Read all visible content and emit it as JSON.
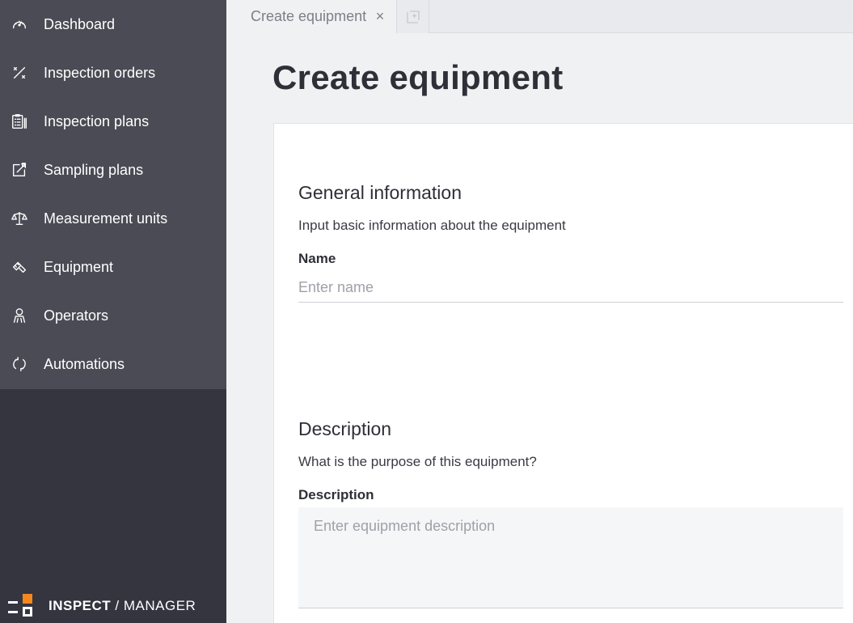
{
  "sidebar": {
    "items": [
      {
        "label": "Dashboard",
        "icon": "gauge-icon"
      },
      {
        "label": "Inspection orders",
        "icon": "percent-icon"
      },
      {
        "label": "Inspection plans",
        "icon": "clipboard-list-icon"
      },
      {
        "label": "Sampling plans",
        "icon": "chart-export-icon"
      },
      {
        "label": "Measurement units",
        "icon": "scale-icon"
      },
      {
        "label": "Equipment",
        "icon": "tools-icon"
      },
      {
        "label": "Operators",
        "icon": "person-icon"
      },
      {
        "label": "Automations",
        "icon": "refresh-icon"
      }
    ],
    "brand": {
      "part1": "INSPECT",
      "separator": " / ",
      "part2": "MANAGER",
      "accent_color": "#f5871f"
    }
  },
  "tabs": {
    "active_label": "Create equipment",
    "close_symbol": "×"
  },
  "page": {
    "title": "Create equipment"
  },
  "general": {
    "title": "General information",
    "subtitle": "Input basic information about the equipment",
    "name_label": "Name",
    "name_placeholder": "Enter name",
    "name_value": ""
  },
  "description": {
    "title": "Description",
    "subtitle": "What is the purpose of this equipment?",
    "field_label": "Description",
    "placeholder": "Enter equipment description",
    "value": ""
  },
  "colors": {
    "sidebar_bg": "#34353f",
    "nav_bg": "#4a4b54",
    "page_bg": "#f0f1f3",
    "card_bg": "#ffffff",
    "brand_accent": "#f5871f"
  }
}
